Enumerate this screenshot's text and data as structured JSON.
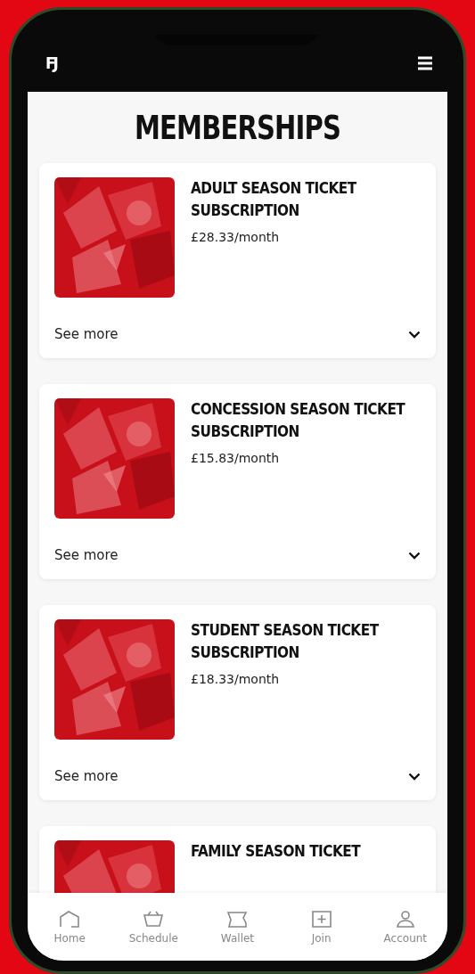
{
  "header": {
    "logo": "FJ"
  },
  "page_title": "MEMBERSHIPS",
  "memberships": [
    {
      "title": "ADULT SEASON TICKET SUBSCRIPTION",
      "price": "£28.33/month",
      "toggle": "See more",
      "expanded": false
    },
    {
      "title": "CONCESSION SEASON TICKET SUBSCRIPTION",
      "price": "£15.83/month",
      "toggle": "See more",
      "expanded": false
    },
    {
      "title": "STUDENT SEASON TICKET SUBSCRIPTION",
      "price": "£18.33/month",
      "toggle": "See more",
      "expanded": false
    },
    {
      "title": "FAMILY SEASON TICKET"
    }
  ],
  "bottom_nav": [
    {
      "label": "Home",
      "kind": "home"
    },
    {
      "label": "Schedule",
      "kind": "basket"
    },
    {
      "label": "Wallet",
      "kind": "ticket"
    },
    {
      "label": "Join",
      "kind": "plus"
    },
    {
      "label": "Account",
      "kind": "person"
    }
  ]
}
